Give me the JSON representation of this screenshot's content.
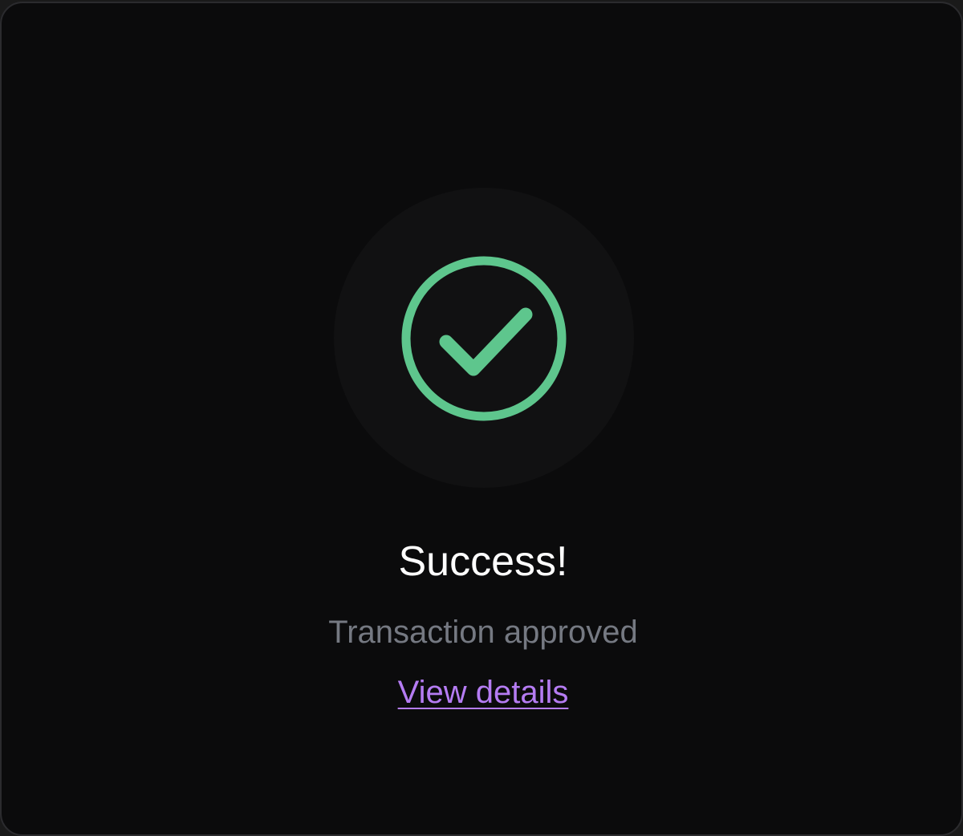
{
  "status": {
    "title": "Success!",
    "message": "Transaction approved",
    "link_label": "View details",
    "icon": "check-circle-icon"
  },
  "colors": {
    "background": "#0b0b0c",
    "halo": "#111112",
    "success": "#5ec68d",
    "title": "#ffffff",
    "message": "#757982",
    "link": "#b57cf3"
  }
}
